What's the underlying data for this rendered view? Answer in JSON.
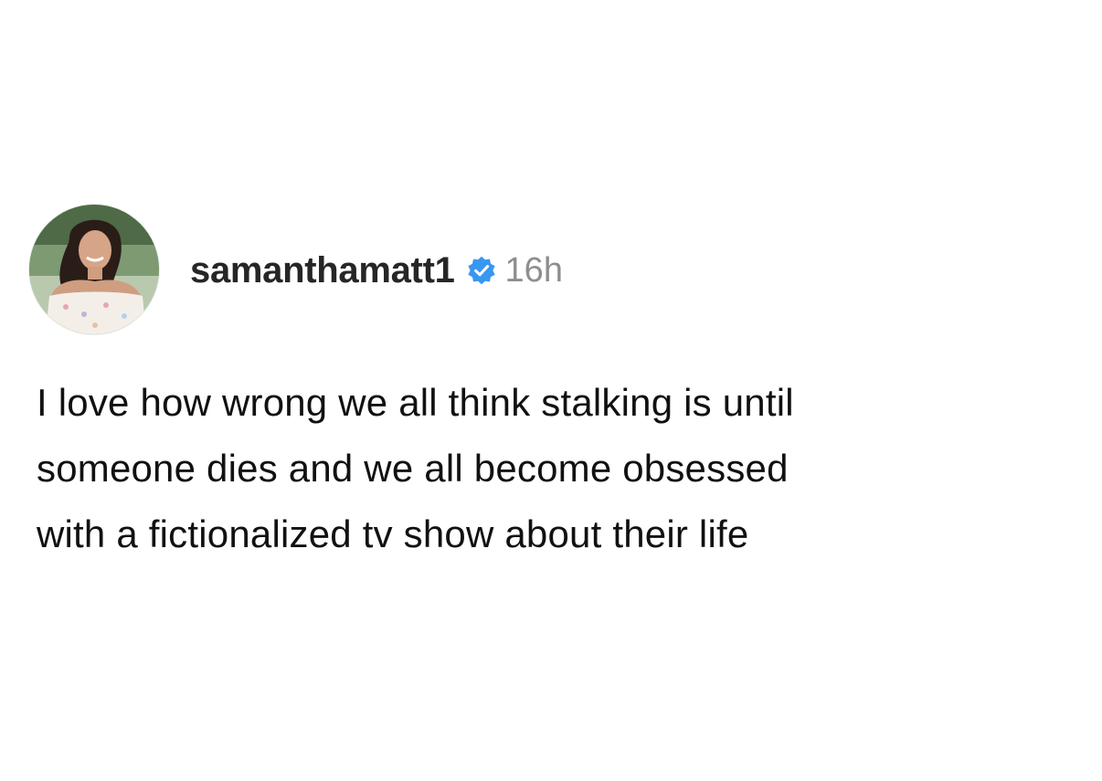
{
  "post": {
    "username": "samanthamatt1",
    "verified": true,
    "timestamp": "16h",
    "avatar_icon": "profile-photo",
    "verified_icon": "verified-badge-icon",
    "colors": {
      "verified": "#3897f0",
      "timestamp": "#8e8e8e",
      "username": "#262626",
      "text": "#111111"
    },
    "lines": [
      "I love how wrong we all think stalking is until",
      "someone dies and we all become obsessed",
      "with a fictionalized tv show about their life"
    ]
  }
}
